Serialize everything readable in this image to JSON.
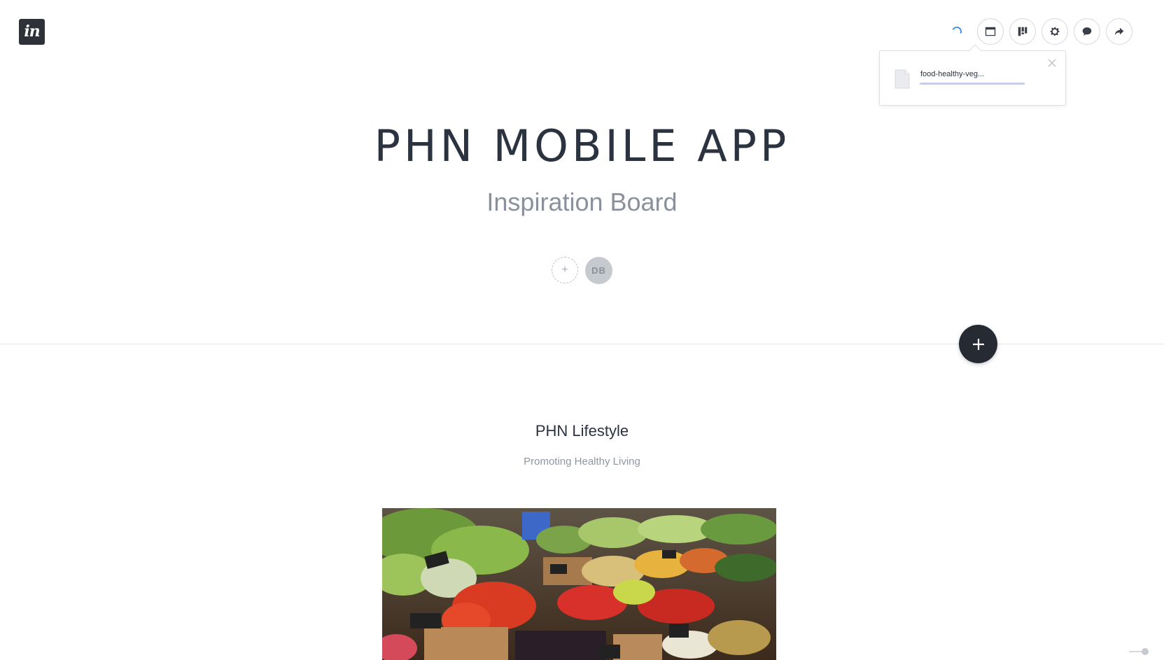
{
  "app": {
    "logo_text": "in"
  },
  "toolbar": {
    "items": [
      {
        "icon": "browser-window-icon"
      },
      {
        "icon": "board-layout-icon"
      },
      {
        "icon": "gear-icon"
      },
      {
        "icon": "comment-icon"
      },
      {
        "icon": "share-arrow-icon"
      }
    ]
  },
  "upload": {
    "file_name": "food-healthy-veg...",
    "progress_fraction": 1.0
  },
  "board": {
    "title": "PHN MOBILE APP",
    "subtitle": "Inspiration Board",
    "add_collaborator_symbol": "+",
    "collaborator_initials": "DB"
  },
  "section": {
    "title": "PHN Lifestyle",
    "subtitle": "Promoting Healthy Living"
  },
  "colors": {
    "dark": "#252a33",
    "muted_text": "#8a919c",
    "accent_spinner": "#4a90e2"
  }
}
